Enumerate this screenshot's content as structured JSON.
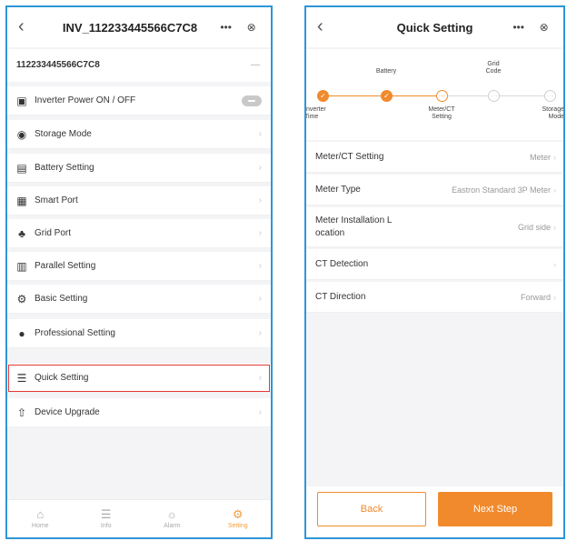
{
  "screen1": {
    "title": "INV_112233445566C7C8",
    "capsule_more": "•••",
    "capsule_close": "⊗",
    "serial": "112233445566C7C8",
    "serial_trailing": "—",
    "items": [
      {
        "label": "Inverter Power ON / OFF",
        "icon": "power-icon",
        "glyph": "▣"
      },
      {
        "label": "Storage Mode",
        "icon": "storage-mode-icon",
        "glyph": "◉"
      },
      {
        "label": "Battery Setting",
        "icon": "battery-icon",
        "glyph": "▤"
      },
      {
        "label": "Smart Port",
        "icon": "smart-port-icon",
        "glyph": "▦"
      },
      {
        "label": "Grid Port",
        "icon": "grid-tower-icon",
        "glyph": "♣"
      },
      {
        "label": "Parallel Setting",
        "icon": "parallel-icon",
        "glyph": "▥"
      },
      {
        "label": "Basic Setting",
        "icon": "gear-icon",
        "glyph": "⚙"
      },
      {
        "label": "Professional Setting",
        "icon": "professional-icon",
        "glyph": "●"
      },
      {
        "label": "Quick Setting",
        "icon": "sliders-icon",
        "glyph": "☰"
      },
      {
        "label": "Device Upgrade",
        "icon": "upgrade-icon",
        "glyph": "⇧"
      }
    ],
    "nav": [
      {
        "label": "Home",
        "icon": "home-icon",
        "glyph": "⌂"
      },
      {
        "label": "Info",
        "icon": "info-icon",
        "glyph": "☰"
      },
      {
        "label": "Alarm",
        "icon": "alarm-icon",
        "glyph": "☼"
      },
      {
        "label": "Setting",
        "icon": "setting-icon",
        "glyph": "⚙"
      }
    ],
    "highlight_color": "#e53935"
  },
  "screen2": {
    "title": "Quick Setting",
    "capsule_more": "•••",
    "capsule_close": "⊗",
    "steps": [
      {
        "label": "Inverter\nTime",
        "state": "done"
      },
      {
        "label": "Battery",
        "state": "done"
      },
      {
        "label": "Meter/CT\nSetting",
        "state": "current"
      },
      {
        "label": "Grid\nCode",
        "state": "todo"
      },
      {
        "label": "Storage\nMode",
        "state": "todo"
      }
    ],
    "rows": [
      {
        "label": "Meter/CT Setting",
        "value": "Meter"
      },
      {
        "label": "Meter Type",
        "value": "Eastron Standard 3P Meter"
      },
      {
        "label": "Meter Installation L\nocation",
        "value": "Grid side"
      },
      {
        "label": "CT Detection",
        "value": ""
      },
      {
        "label": "CT Direction",
        "value": "Forward"
      }
    ],
    "back_label": "Back",
    "next_label": "Next Step",
    "accent": "#f08a2c"
  },
  "frame_color": "#2f96d6"
}
